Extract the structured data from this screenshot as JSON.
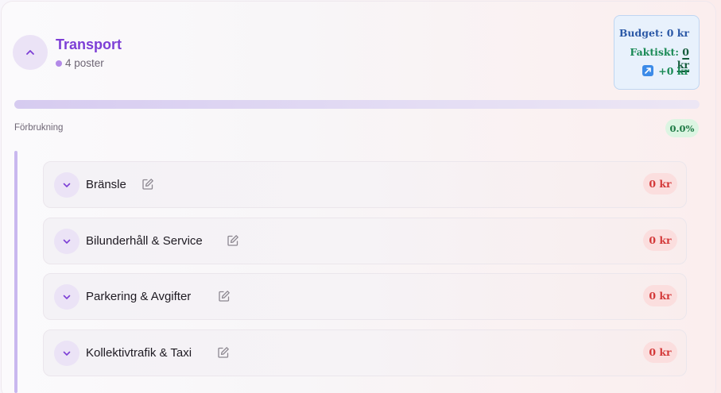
{
  "category": {
    "title": "Transport",
    "subtitle": "4 poster",
    "collapse_icon": "chevron-up-icon"
  },
  "budget_box": {
    "budget_label": "Budget:",
    "budget_value": "0 kr",
    "actual_label": "Faktiskt:",
    "actual_value": "0 kr",
    "diff_icon": "trend-up-arrow-icon",
    "diff_value": "+0 kr"
  },
  "progress": {
    "label": "Förbrukning",
    "percent_text": "0.0%",
    "fraction": 0.0
  },
  "items": [
    {
      "label": "Bränsle",
      "amount": "0 kr"
    },
    {
      "label": "Bilunderhåll & Service",
      "amount": "0 kr"
    },
    {
      "label": "Parkering & Avgifter",
      "amount": "0 kr"
    },
    {
      "label": "Kollektivtrafik & Taxi",
      "amount": "0 kr"
    }
  ],
  "colors": {
    "accent": "#7d3fd6",
    "negative": "#d43a3a",
    "positive": "#1a8a55",
    "budget": "#2b58a6"
  }
}
